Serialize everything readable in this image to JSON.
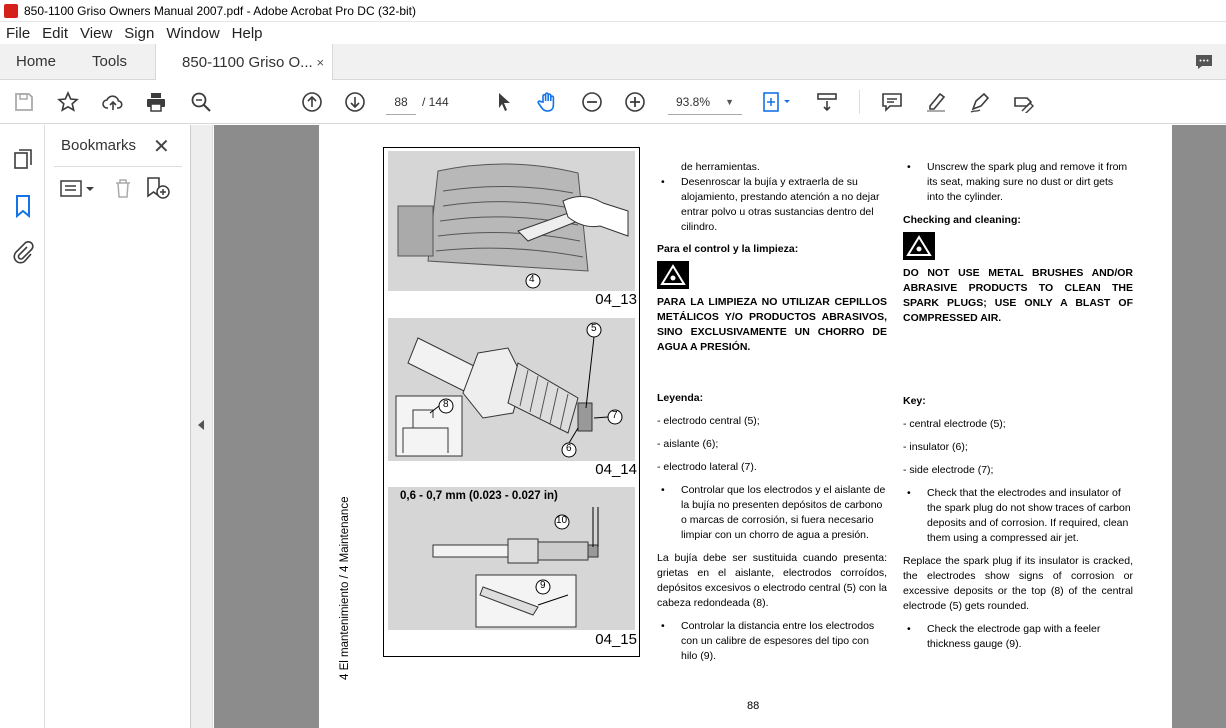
{
  "window": {
    "title": "850-1100 Griso Owners Manual 2007.pdf - Adobe Acrobat Pro DC (32-bit)"
  },
  "menu": [
    "File",
    "Edit",
    "View",
    "Sign",
    "Window",
    "Help"
  ],
  "tabs": {
    "home": "Home",
    "tools": "Tools",
    "document": "850-1100 Griso O...",
    "close": "×"
  },
  "toolbar": {
    "page_current": "88",
    "page_total": "/ 144",
    "zoom": "93.8%"
  },
  "bookmarks": {
    "title": "Bookmarks",
    "close": "✕"
  },
  "figures": {
    "fig1_label": "04_13",
    "fig2_label": "04_14",
    "fig3_label": "04_15",
    "callouts": {
      "c4": "4",
      "c5": "5",
      "c6": "6",
      "c7": "7",
      "c8": "8",
      "c9": "9",
      "c10": "10"
    },
    "gap_label": "0,6 - 0,7 mm (0.023 - 0.027 in)"
  },
  "page": {
    "vertical_header": "4 El mantenimiento / 4 Maintenance",
    "page_number": "88",
    "es": {
      "top_line": "de herramientas.",
      "bullet_unscrew": "Desenroscar la bujía y extraerla de su alojamiento, prestando atención a no dejar entrar polvo u otras sustancias dentro del cilindro.",
      "check_heading": "Para el control y la limpieza:",
      "warning": "PARA LA LIMPIEZA NO UTILIZAR CEPILLOS METÁLICOS Y/O PRODUCTOS ABRASIVOS, SINO EXCLUSIVAMENTE UN CHORRO DE AGUA A PRESIÓN.",
      "legend_heading": "Leyenda:",
      "legend1": "- electrodo central (5);",
      "legend2": "- aislante (6);",
      "legend3": "- electrodo lateral (7).",
      "bullet_check": "Controlar que los electrodos y el aislante de la bujía no presenten depósitos de carbono o marcas de corrosión, si fuera necesario limpiar con un chorro de agua a presión.",
      "replace": "La bujía debe ser sustituida cuando presenta: grietas en el aislante, electrodos corroídos, depósitos excesivos o electrodo central (5) con la cabeza redondeada (8).",
      "bullet_gap": "Controlar la distancia entre los electrodos con un calibre de espesores del tipo con hilo (9)."
    },
    "en": {
      "bullet_unscrew": "Unscrew the spark plug and remove it from its seat, making sure no dust or dirt gets into the cylinder.",
      "check_heading": "Checking and cleaning:",
      "warning": "DO NOT USE METAL BRUSHES AND/OR ABRASIVE PRODUCTS TO CLEAN THE SPARK PLUGS; USE ONLY A BLAST OF COMPRESSED AIR.",
      "legend_heading": "Key:",
      "legend1": "- central electrode (5);",
      "legend2": "- insulator (6);",
      "legend3": "- side electrode (7);",
      "bullet_check": "Check that the electrodes and insulator of the spark plug do not show traces of carbon deposits and of corrosion. If required, clean them using a compressed air jet.",
      "replace": "Replace the spark plug if its insulator is cracked, the electrodes show signs of corrosion or excessive deposits or the top (8) of the central electrode (5) gets rounded.",
      "bullet_gap": "Check the electrode gap with a feeler thickness gauge (9)."
    }
  },
  "colors": {
    "accent": "#d4221a",
    "doc_background": "#8c8c8c",
    "tab_bar": "#f1f1f1",
    "icon": "#3c3c3c",
    "bookmark_blue": "#1473e6"
  }
}
